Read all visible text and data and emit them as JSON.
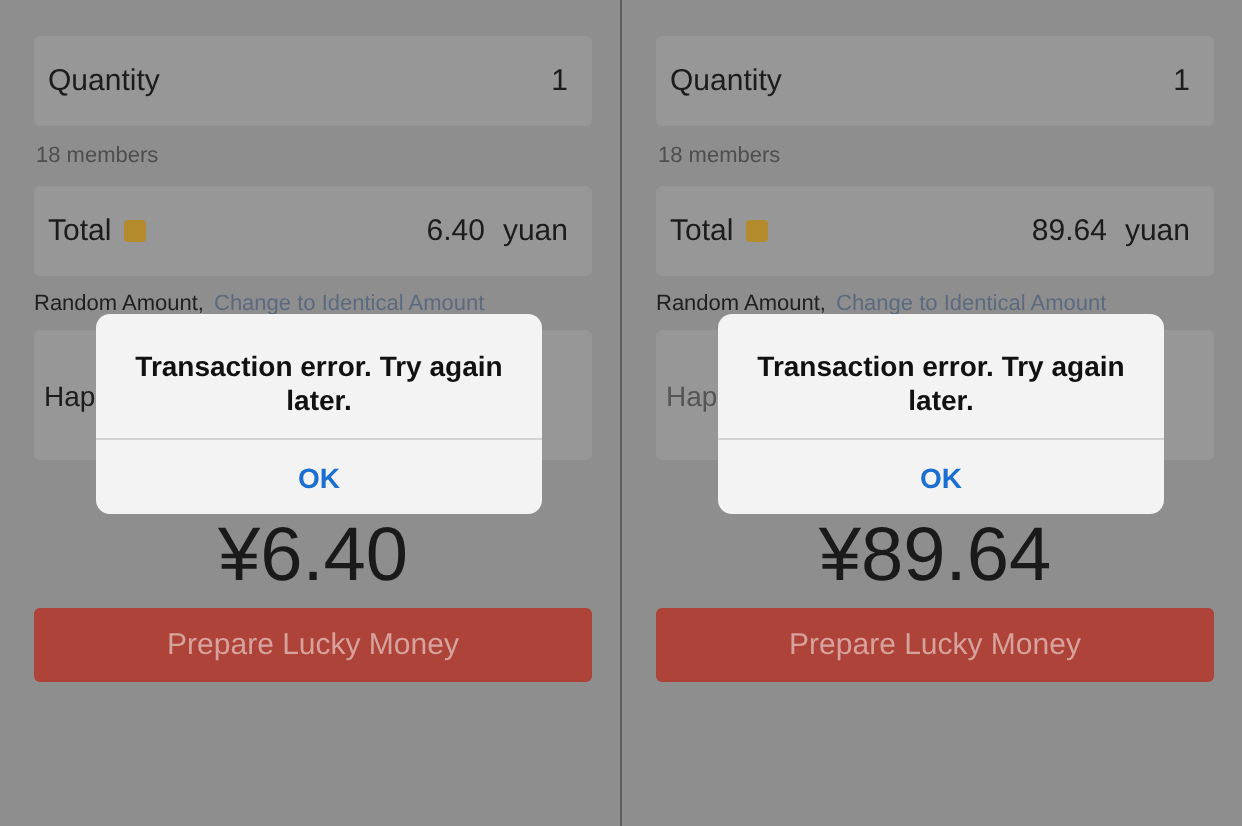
{
  "screens": [
    {
      "quantity": {
        "label": "Quantity",
        "value": "1"
      },
      "members_note": "18 members",
      "total": {
        "label": "Total",
        "value": "6.40",
        "unit": "yuan"
      },
      "amount_mode": "Random Amount,",
      "change_link": "Change to Identical Amount",
      "greeting": {
        "text": "Hap",
        "placeholder": false
      },
      "amount": "¥6.40",
      "submit_button": "Prepare Lucky Money",
      "alert": {
        "message": "Transaction error. Try again later.",
        "button": "OK"
      }
    },
    {
      "quantity": {
        "label": "Quantity",
        "value": "1"
      },
      "members_note": "18 members",
      "total": {
        "label": "Total",
        "value": "89.64",
        "unit": "yuan"
      },
      "amount_mode": "Random Amount,",
      "change_link": "Change to Identical Amount",
      "greeting": {
        "text": "Hap",
        "placeholder": true
      },
      "amount": "¥89.64",
      "submit_button": "Prepare Lucky Money",
      "alert": {
        "message": "Transaction error. Try again later.",
        "button": "OK"
      }
    }
  ]
}
